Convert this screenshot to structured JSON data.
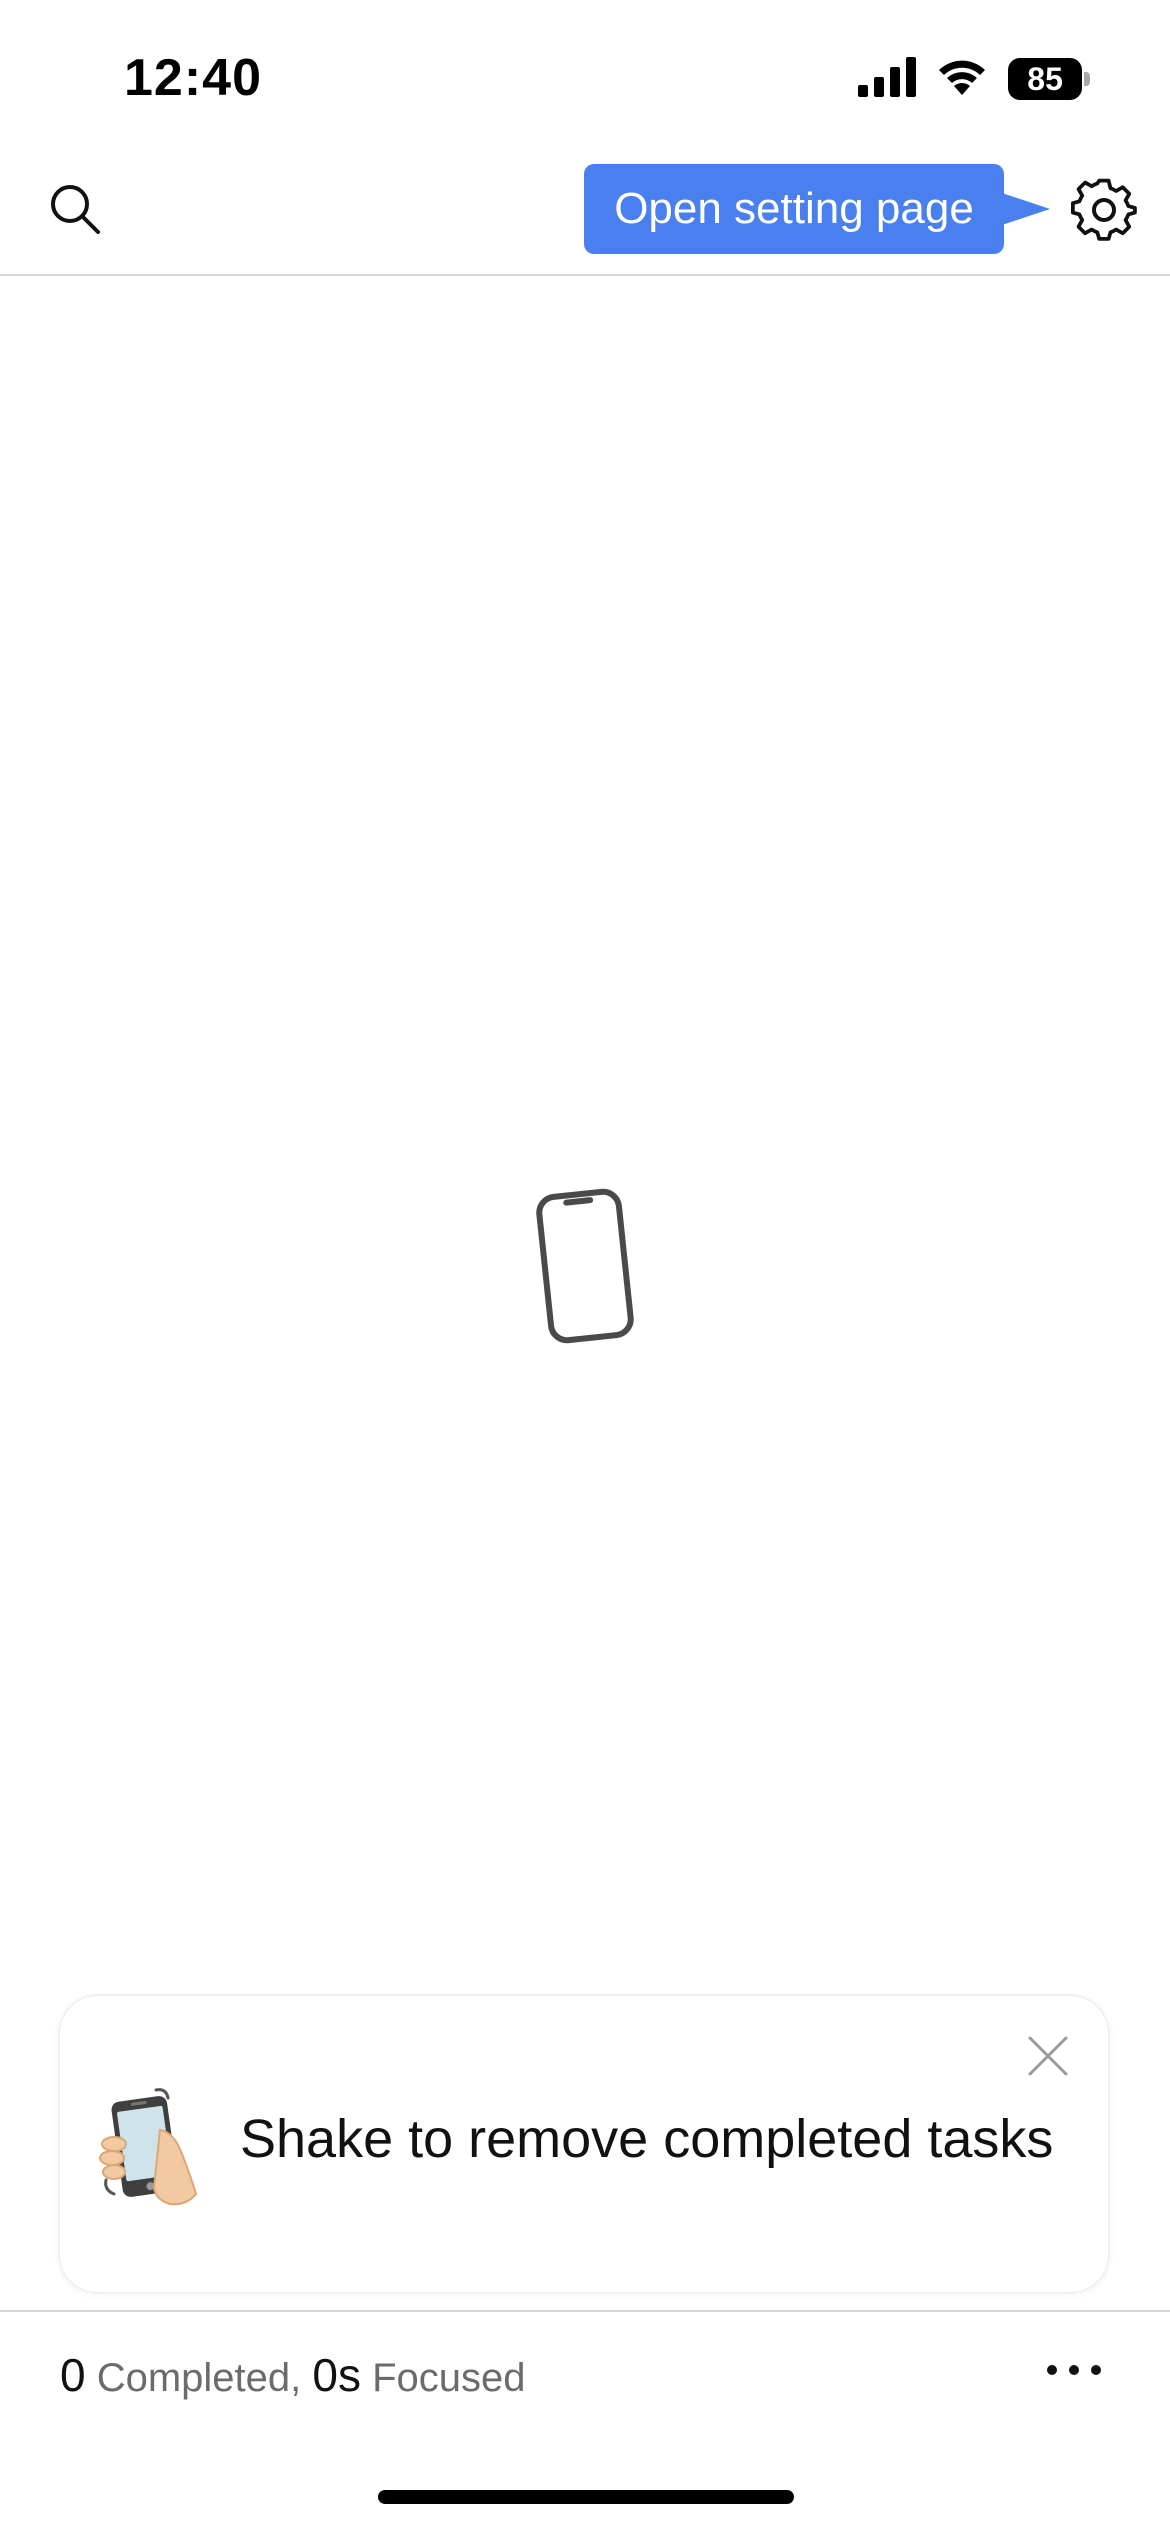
{
  "status_bar": {
    "time": "12:40",
    "battery": "85"
  },
  "nav": {
    "tooltip": "Open setting page"
  },
  "tip": {
    "text": "Shake to remove completed tasks"
  },
  "stats": {
    "completed_count": "0",
    "completed_label": " Completed, ",
    "focused_value": "0s",
    "focused_label": " Focused"
  },
  "icons": {
    "search": "search-icon",
    "settings": "gear-icon",
    "close": "close-icon",
    "more": "more-icon",
    "empty": "phone-icon",
    "tip": "shake-phone-icon"
  },
  "colors": {
    "accent": "#4a7ff0",
    "icon_gray": "#4a4a4a",
    "divider": "#d6d6d6"
  }
}
